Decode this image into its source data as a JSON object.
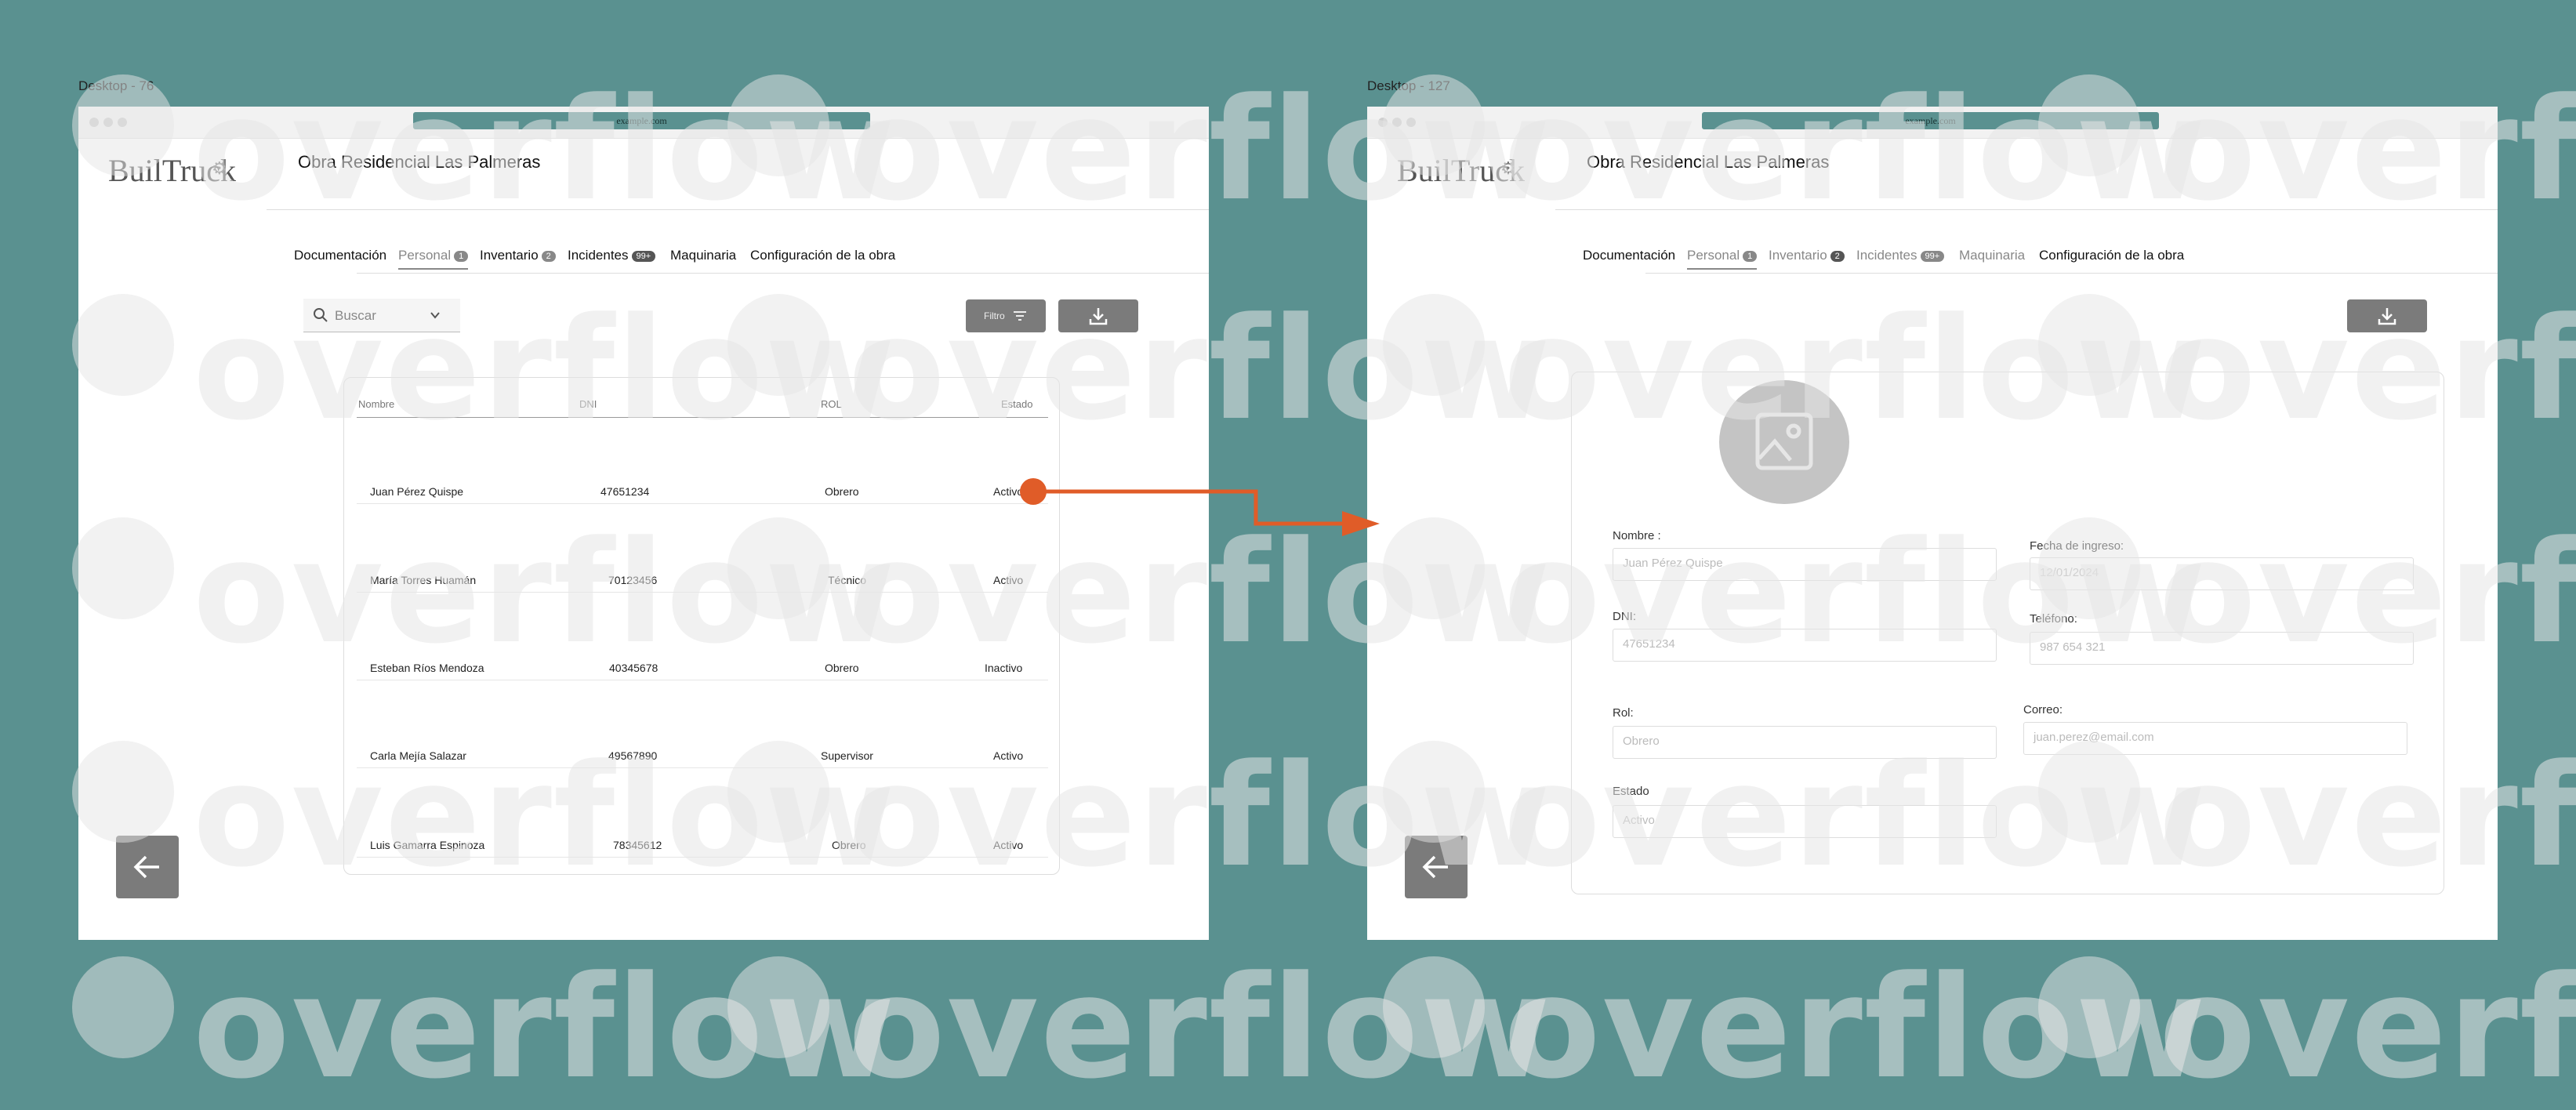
{
  "colors": {
    "background": "#5a9190",
    "button": "#7b7b7b",
    "connector": "#e05c28"
  },
  "watermark": "overflow",
  "frames": [
    {
      "label": "Desktop - 76",
      "url": "example.com",
      "logo": "BuilTruck",
      "project_title": "Obra Residencial Las Palmeras",
      "tabs": [
        {
          "label": "Documentación"
        },
        {
          "label": "Personal",
          "badge": "1"
        },
        {
          "label": "Inventario",
          "badge": "2"
        },
        {
          "label": "Incidentes",
          "badge": "99+"
        },
        {
          "label": "Maquinaria"
        },
        {
          "label": "Configuración de la obra"
        }
      ],
      "search_placeholder": "Buscar",
      "filter_label": "Filtro",
      "table": {
        "headers": [
          "Nombre",
          "DNI",
          "ROL",
          "Estado"
        ],
        "rows": [
          [
            "Juan Pérez Quispe",
            "47651234",
            "Obrero",
            "Activo"
          ],
          [
            "María Torres Huamán",
            "70123456",
            "Técnico",
            "Activo"
          ],
          [
            "Esteban Ríos Mendoza",
            "40345678",
            "Obrero",
            "Inactivo"
          ],
          [
            "Carla Mejía Salazar",
            "49567890",
            "Supervisor",
            "Activo"
          ],
          [
            "Luis Gamarra Espinoza",
            "78345612",
            "Obrero",
            "Activo"
          ]
        ]
      }
    },
    {
      "label": "Desktop - 127",
      "url": "example.com",
      "logo": "BuilTruck",
      "project_title": "Obra Residencial Las Palmeras",
      "tabs": [
        {
          "label": "Documentación"
        },
        {
          "label": "Personal",
          "badge": "1"
        },
        {
          "label": "Inventario",
          "badge": "2"
        },
        {
          "label": "Incidentes",
          "badge": "99+"
        },
        {
          "label": "Maquinaria"
        },
        {
          "label": "Configuración de la obra"
        }
      ],
      "form": {
        "nombre_label": "Nombre :",
        "nombre_value": "Juan Pérez Quispe",
        "dni_label": "DNI:",
        "dni_value": "47651234",
        "rol_label": "Rol:",
        "rol_value": "Obrero",
        "estado_label": "Estado",
        "estado_value": "Activo",
        "fecha_label": "Fecha de ingreso:",
        "fecha_value": "12/01/2024",
        "telefono_label": "Teléfono:",
        "telefono_value": "987 654 321",
        "correo_label": "Correo:",
        "correo_value": "juan.perez@email.com"
      }
    }
  ]
}
